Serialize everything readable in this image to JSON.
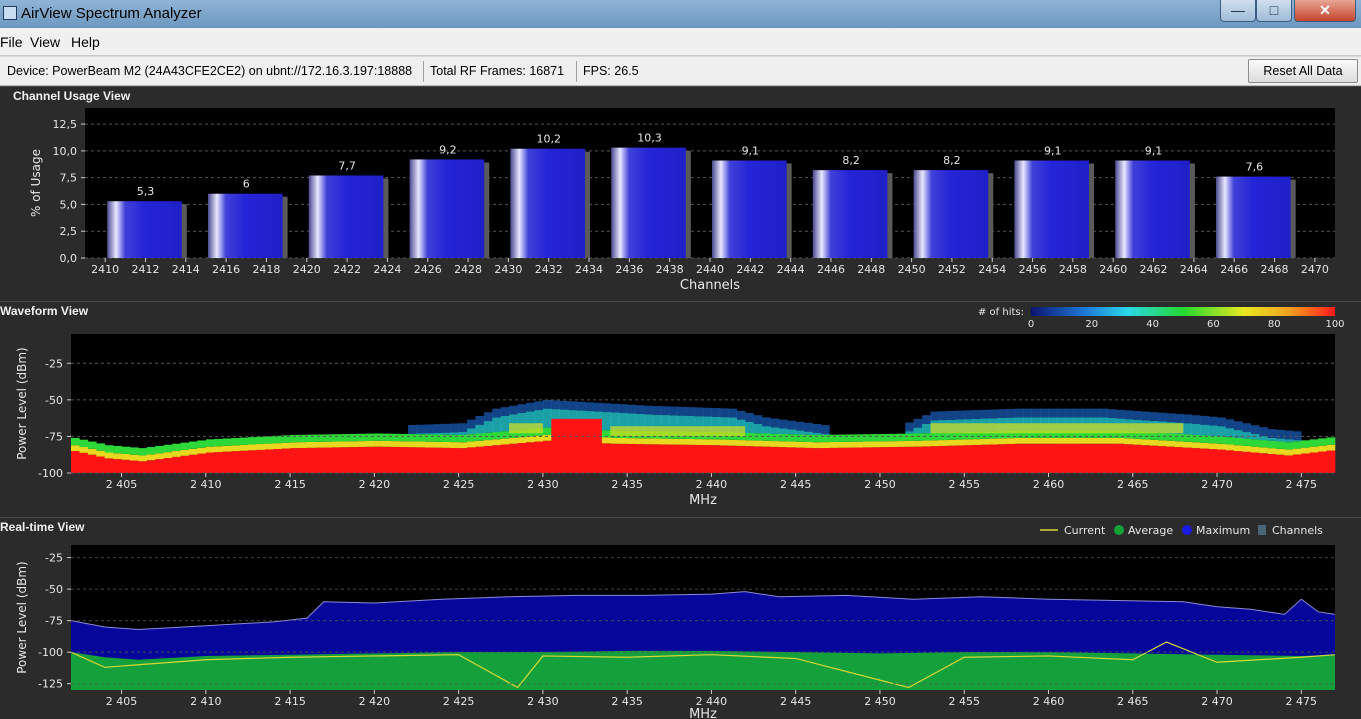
{
  "window": {
    "title": "AirView Spectrum Analyzer",
    "minimize": "—",
    "maximize": "□",
    "close": "✕"
  },
  "menu": [
    "File",
    "View",
    "Help"
  ],
  "status": {
    "device": "Device: PowerBeam M2 (24A43CFE2CE2) on ubnt://172.16.3.197:18888",
    "frames": "Total RF Frames: 16871",
    "fps": "FPS: 26.5",
    "reset_label": "Reset All Data"
  },
  "colors": {
    "bar": "#2424d8",
    "maximum": "#0a0a9a",
    "average": "#13a236",
    "current": "#d8d838",
    "channels": "#4a6478",
    "panel": "#2b2b2b",
    "plot": "#000000"
  },
  "icons": {
    "app": "airview-icon"
  },
  "panels": {
    "channel_usage": {
      "title": "Channel Usage View"
    },
    "waveform": {
      "title": "Waveform View",
      "legend_label": "# of hits:"
    },
    "realtime": {
      "title": "Real-time View"
    }
  },
  "chart_data": [
    {
      "type": "bar",
      "title": "Channel Usage View",
      "xlabel": "Channels",
      "ylabel": "% of Usage",
      "categories": [
        "2412",
        "2417",
        "2422",
        "2427",
        "2432",
        "2437",
        "2442",
        "2447",
        "2452",
        "2457",
        "2462",
        "2467"
      ],
      "values": [
        5.3,
        6,
        7.7,
        9.2,
        10.2,
        10.3,
        9.1,
        8.2,
        8.2,
        9.1,
        9.1,
        7.6
      ],
      "value_labels": [
        "5,3",
        "6",
        "7,7",
        "9,2",
        "10,2",
        "10,3",
        "9,1",
        "8,2",
        "8,2",
        "9,1",
        "9,1",
        "7,6"
      ],
      "xlim": [
        2409,
        2471
      ],
      "ylim": [
        0,
        14
      ],
      "x_ticks": [
        "2410",
        "2412",
        "2414",
        "2416",
        "2418",
        "2420",
        "2422",
        "2424",
        "2426",
        "2428",
        "2430",
        "2432",
        "2434",
        "2436",
        "2438",
        "2440",
        "2442",
        "2444",
        "2446",
        "2448",
        "2450",
        "2452",
        "2454",
        "2456",
        "2458",
        "2460",
        "2462",
        "2464",
        "2466",
        "2468",
        "2470"
      ],
      "y_ticks": [
        "0,0",
        "2,5",
        "5,0",
        "7,5",
        "10,0",
        "12,5"
      ],
      "grid": true
    },
    {
      "type": "heatmap",
      "title": "Waveform View",
      "xlabel": "MHz",
      "ylabel": "Power Level (dBm)",
      "xlim": [
        2402,
        2477
      ],
      "ylim": [
        -100,
        -5
      ],
      "x_ticks": [
        "2 405",
        "2 410",
        "2 415",
        "2 420",
        "2 425",
        "2 430",
        "2 435",
        "2 440",
        "2 445",
        "2 450",
        "2 455",
        "2 460",
        "2 465",
        "2 470",
        "2 475"
      ],
      "y_ticks": [
        "-100",
        "-75",
        "-50",
        "-25"
      ],
      "colorbar_label": "# of hits:",
      "colorbar_ticks": [
        "0",
        "20",
        "40",
        "60",
        "80",
        "100"
      ],
      "floor_dbm": [
        [
          2402,
          -85
        ],
        [
          2404,
          -90
        ],
        [
          2406,
          -92
        ],
        [
          2410,
          -86
        ],
        [
          2415,
          -83
        ],
        [
          2420,
          -82
        ],
        [
          2425,
          -83
        ],
        [
          2428,
          -80
        ],
        [
          2430,
          -78
        ],
        [
          2434,
          -80
        ],
        [
          2440,
          -81
        ],
        [
          2446,
          -83
        ],
        [
          2452,
          -82
        ],
        [
          2458,
          -80
        ],
        [
          2464,
          -80
        ],
        [
          2470,
          -84
        ],
        [
          2474,
          -88
        ],
        [
          2477,
          -84
        ]
      ],
      "activity_top_dbm": [
        [
          2402,
          -80
        ],
        [
          2405,
          -88
        ],
        [
          2410,
          -80
        ],
        [
          2415,
          -76
        ],
        [
          2420,
          -74
        ],
        [
          2425,
          -72
        ],
        [
          2427,
          -62
        ],
        [
          2430,
          -56
        ],
        [
          2433,
          -58
        ],
        [
          2436,
          -60
        ],
        [
          2441,
          -62
        ],
        [
          2443,
          -68
        ],
        [
          2447,
          -74
        ],
        [
          2451,
          -74
        ],
        [
          2453,
          -64
        ],
        [
          2458,
          -62
        ],
        [
          2463,
          -62
        ],
        [
          2468,
          -66
        ],
        [
          2470,
          -68
        ],
        [
          2473,
          -76
        ],
        [
          2477,
          -80
        ]
      ]
    },
    {
      "type": "area",
      "title": "Real-time View",
      "xlabel": "MHz",
      "ylabel": "Power Level (dBm)",
      "xlim": [
        2402,
        2477
      ],
      "ylim": [
        -130,
        -15
      ],
      "x_ticks": [
        "2 405",
        "2 410",
        "2 415",
        "2 420",
        "2 425",
        "2 430",
        "2 435",
        "2 440",
        "2 445",
        "2 450",
        "2 455",
        "2 460",
        "2 465",
        "2 470",
        "2 475"
      ],
      "y_ticks": [
        "-125",
        "-100",
        "-75",
        "-50",
        "-25"
      ],
      "legend": [
        "Current",
        "Average",
        "Maximum",
        "Channels"
      ],
      "series": [
        {
          "name": "Maximum",
          "x": [
            2402,
            2404,
            2406,
            2410,
            2414,
            2416,
            2417,
            2420,
            2424,
            2426,
            2428,
            2432,
            2436,
            2440,
            2442,
            2444,
            2448,
            2452,
            2456,
            2460,
            2464,
            2468,
            2470,
            2472,
            2474,
            2475,
            2476,
            2477
          ],
          "y": [
            -75,
            -80,
            -82,
            -79,
            -76,
            -73,
            -60,
            -61,
            -58,
            -57,
            -56,
            -55,
            -55,
            -54,
            -52,
            -56,
            -55,
            -58,
            -56,
            -58,
            -59,
            -60,
            -64,
            -66,
            -70,
            -58,
            -68,
            -70
          ]
        },
        {
          "name": "Average",
          "x": [
            2402,
            2404,
            2406,
            2410,
            2415,
            2420,
            2425,
            2430,
            2435,
            2440,
            2445,
            2450,
            2455,
            2460,
            2465,
            2470,
            2475,
            2477
          ],
          "y": [
            -100,
            -104,
            -106,
            -103,
            -102,
            -101,
            -100,
            -100,
            -99,
            -99,
            -100,
            -101,
            -100,
            -100,
            -101,
            -102,
            -103,
            -102
          ]
        },
        {
          "name": "Current",
          "x": [
            2402,
            2404,
            2406,
            2410,
            2415,
            2420,
            2425,
            2428.5,
            2430,
            2435,
            2440,
            2445,
            2451.7,
            2455,
            2460,
            2465,
            2467,
            2470,
            2475,
            2477
          ],
          "y": [
            -100,
            -112,
            -110,
            -106,
            -104,
            -103,
            -102,
            -128,
            -103,
            -104,
            -102,
            -105,
            -128,
            -104,
            -103,
            -106,
            -92,
            -108,
            -104,
            -102
          ]
        }
      ]
    }
  ]
}
